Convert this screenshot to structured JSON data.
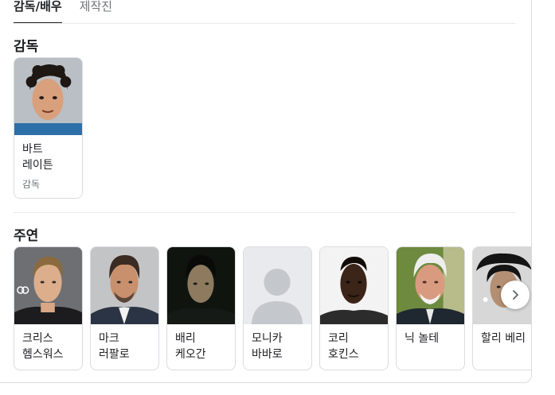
{
  "tabs": [
    {
      "label": "감독/배우",
      "active": true
    },
    {
      "label": "제작진",
      "active": false
    }
  ],
  "sections": {
    "director": {
      "title": "감독",
      "people": [
        {
          "name": "바트 레이튼",
          "role": "감독"
        }
      ]
    },
    "cast": {
      "title": "주연",
      "people": [
        {
          "name": "크리스 헴스워스"
        },
        {
          "name": "마크 러팔로"
        },
        {
          "name": "배리 케오간"
        },
        {
          "name": "모니카 바바로"
        },
        {
          "name": "코리 호킨스"
        },
        {
          "name": "닉 놀테"
        },
        {
          "name": "할리 베리"
        }
      ]
    }
  },
  "icons": {
    "next": "chevron-right-icon",
    "placeholder": "person-silhouette-icon"
  }
}
